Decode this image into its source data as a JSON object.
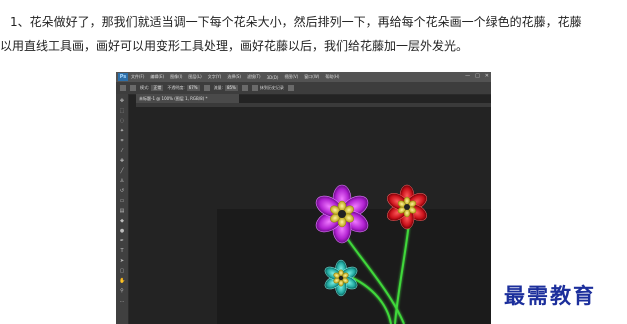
{
  "article": {
    "paragraph_line1": "1、花朵做好了，那我们就适当调一下每个花朵大小，然后排列一下，再给每个花朵画一个绿色的花藤，花藤",
    "paragraph_line2": "以用直线工具画，画好可以用变形工具处理，画好花藤以后，我们给花藤加一层外发光。"
  },
  "photoshop": {
    "logo": "Ps",
    "menu": [
      "文件(F)",
      "编辑(E)",
      "图像(I)",
      "图层(L)",
      "文字(Y)",
      "选择(S)",
      "滤镜(T)",
      "3D(D)",
      "视图(V)",
      "窗口(W)",
      "帮助(H)"
    ],
    "window_controls": [
      "—",
      "□",
      "✕"
    ],
    "options_bar": {
      "mode_label": "模式:",
      "mode_value": "正常",
      "opacity_label": "不透明度:",
      "opacity_value": "67%",
      "flow_label": "流量:",
      "flow_value": "85%",
      "erase_history_label": "抹到历史记录"
    },
    "document_tab": "未标题-1 @ 100% (图层 1, RGB/8) *",
    "colors": {
      "foreground": "#c6f03a",
      "background": "#111111",
      "flower_purple": "#b020d0",
      "flower_red": "#c8101a",
      "flower_teal": "#1fa8a0",
      "stem_green": "#3fd83a"
    }
  },
  "watermark": "最需教育"
}
